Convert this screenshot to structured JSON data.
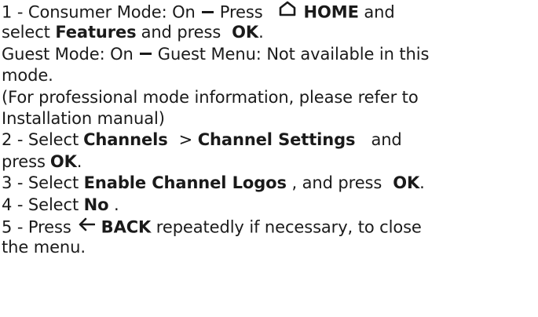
{
  "lines": {
    "l1": {
      "a": "1 -  Consumer Mode: On",
      "b": "Press",
      "home": "HOME",
      "c": "and"
    },
    "l2": {
      "a": "select",
      "features": "Features",
      "b": "and press",
      "ok": "OK",
      "c": "."
    },
    "l3": {
      "a": "Guest Mode: On",
      "b": "Guest Menu: Not available in this"
    },
    "l4": {
      "a": "mode."
    },
    "l5": {
      "a": "(For professional mode information, please refer to"
    },
    "l6": {
      "a": "Installation manual)"
    },
    "l7": {
      "a": "2 -  Select",
      "channels": "Channels",
      "sep": ">",
      "settings": "Channel Settings",
      "b": "and"
    },
    "l8": {
      "a": "press",
      "ok": "OK",
      "c": "."
    },
    "l9": {
      "a": "3 -  Select",
      "logos": "Enable Channel Logos",
      "b": ", and press",
      "ok": "OK",
      "c": "."
    },
    "l10": {
      "a": "4 -  Select",
      "no": "No",
      "c": "."
    },
    "l11": {
      "a": "5 -  Press",
      "back": "BACK",
      "b": "repeatedly if necessary, to close"
    },
    "l12": {
      "a": "the menu."
    }
  },
  "icons": {
    "home": "home-icon",
    "back": "back-arrow-icon",
    "dash": "dash-symbol"
  }
}
